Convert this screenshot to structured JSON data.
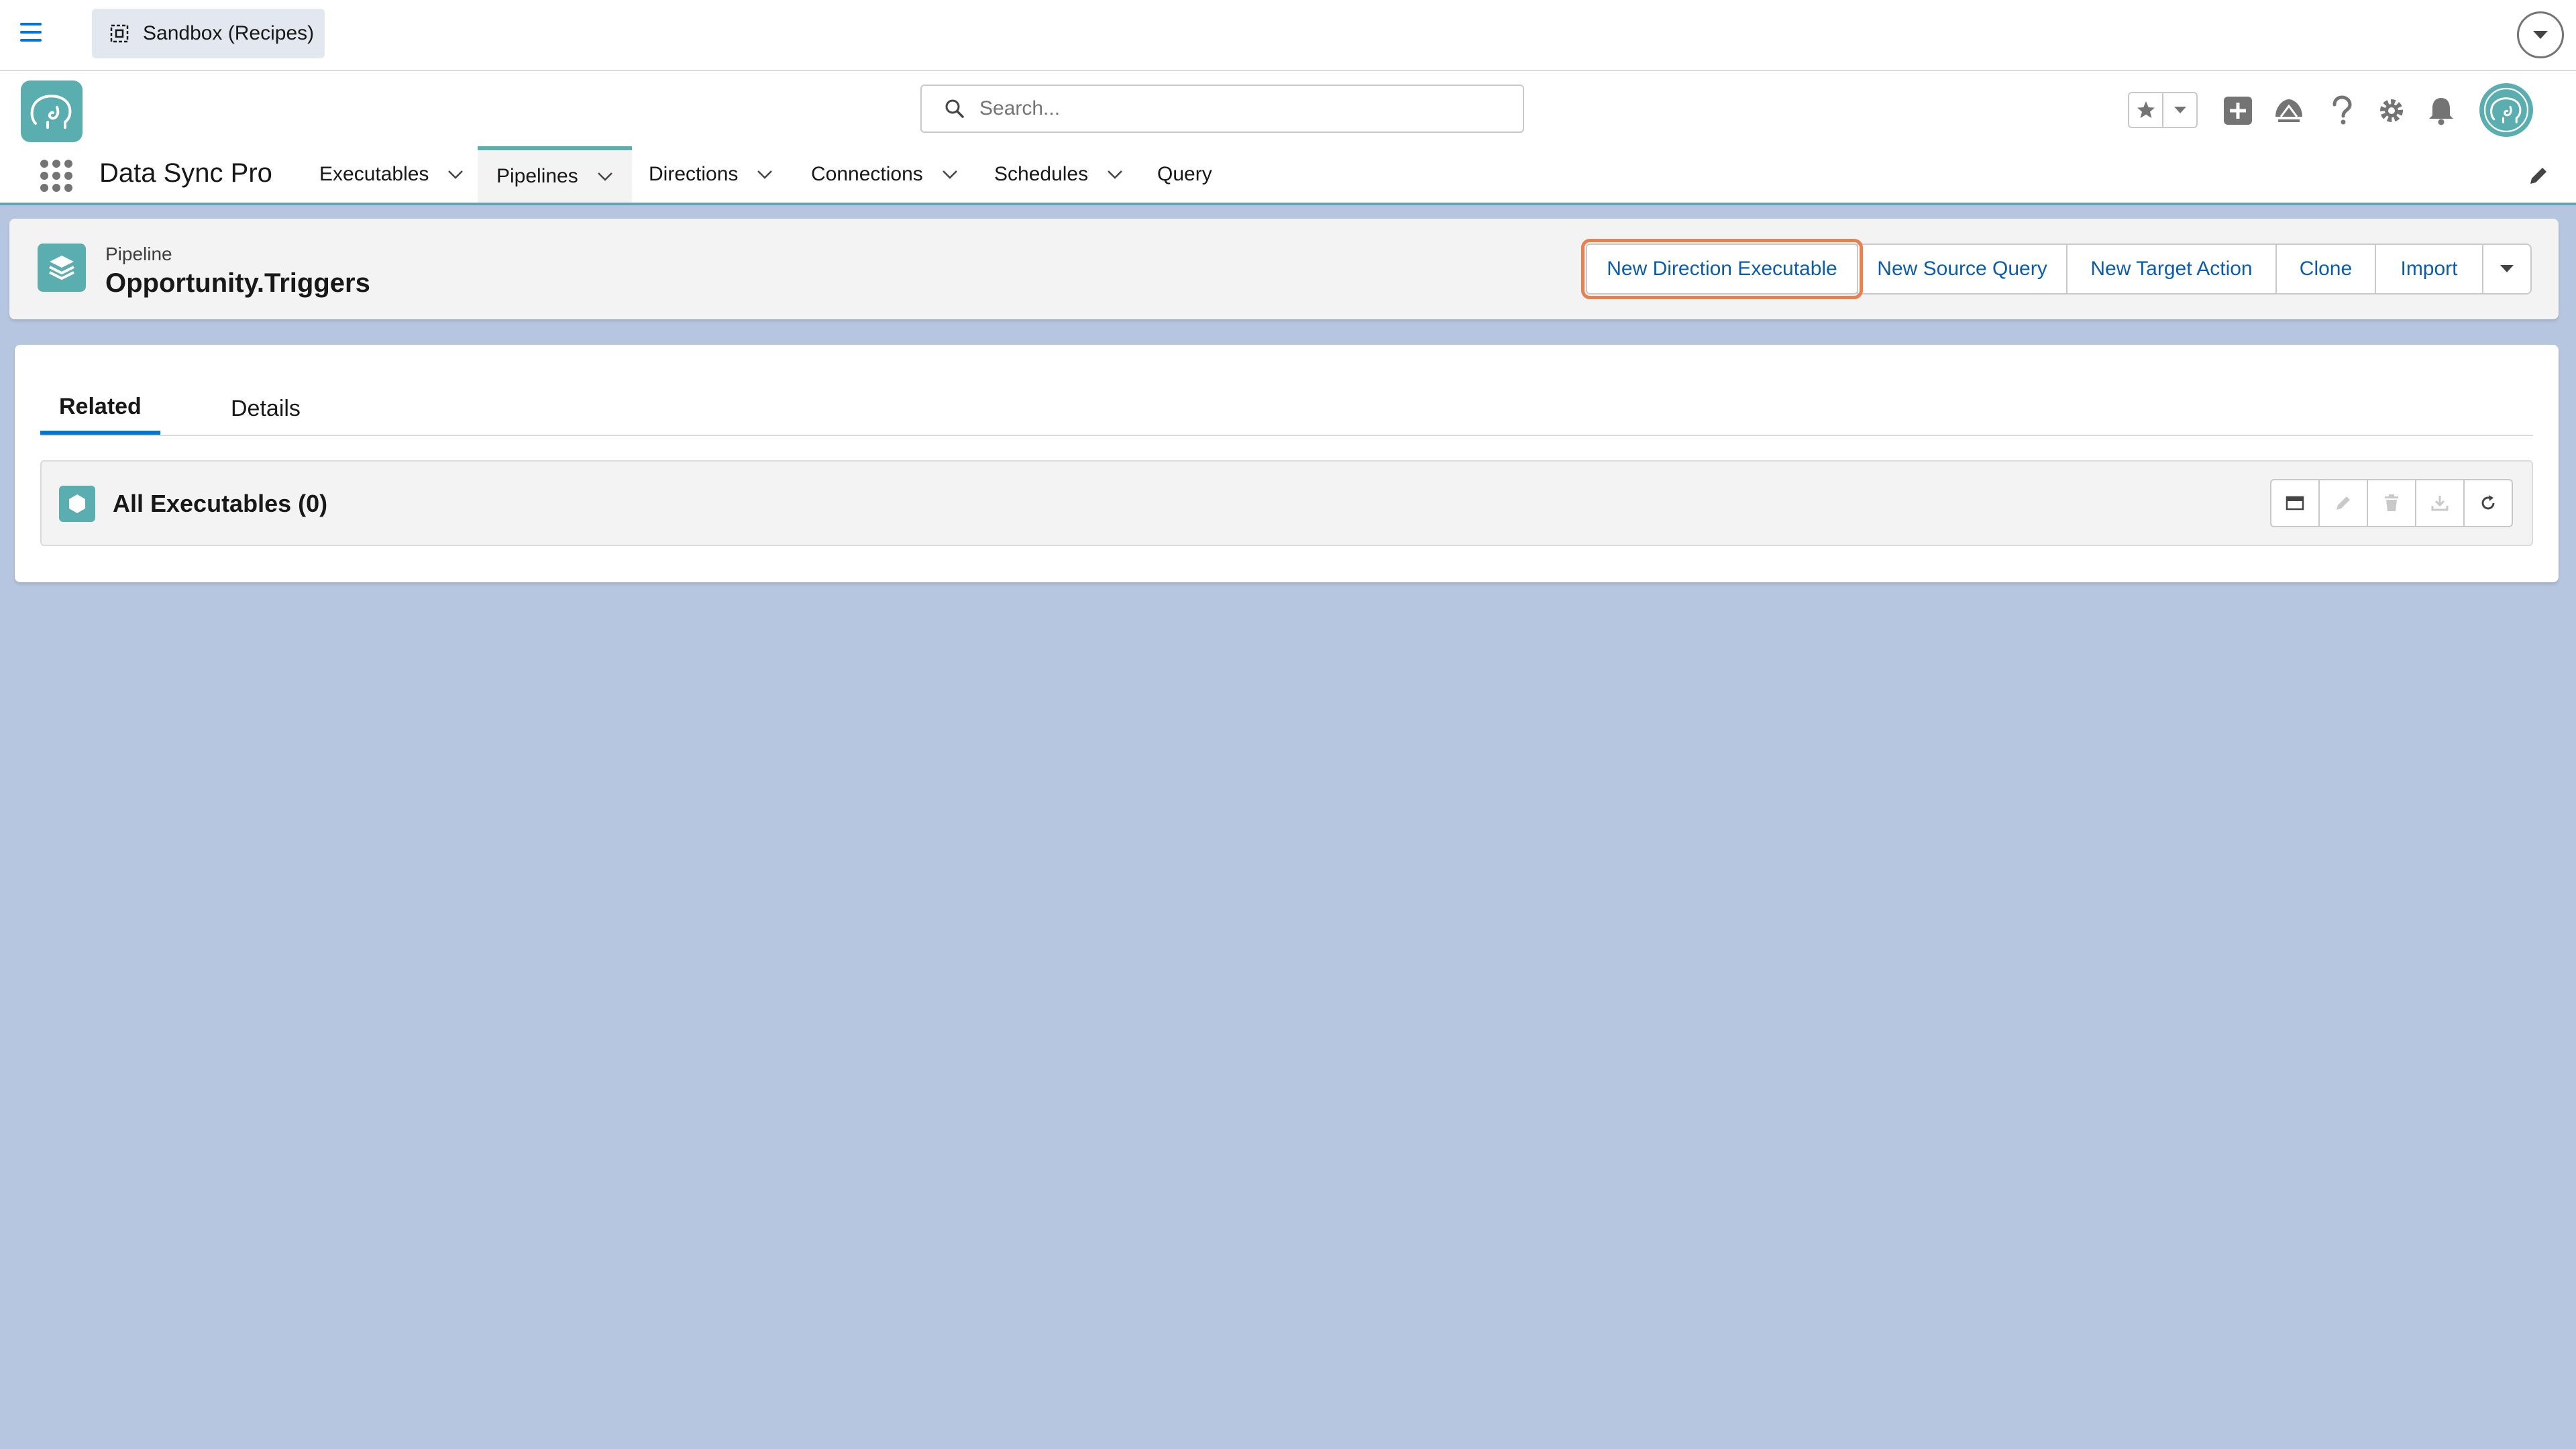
{
  "sandbox_bar": {
    "label": "Sandbox (Recipes)"
  },
  "header": {
    "search_placeholder": "Search...",
    "icons": [
      "favorites-star-icon",
      "favorites-dropdown-icon",
      "add-icon",
      "trailhead-icon",
      "help-icon",
      "setup-gear-icon",
      "notifications-bell-icon",
      "user-avatar-icon"
    ]
  },
  "nav": {
    "app_name": "Data Sync Pro",
    "items": [
      {
        "label": "Executables",
        "has_menu": true
      },
      {
        "label": "Pipelines",
        "has_menu": true,
        "active": true
      },
      {
        "label": "Directions",
        "has_menu": true
      },
      {
        "label": "Connections",
        "has_menu": true
      },
      {
        "label": "Schedules",
        "has_menu": true
      },
      {
        "label": "Query",
        "has_menu": false
      }
    ]
  },
  "record": {
    "type_label": "Pipeline",
    "title": "Opportunity.Triggers",
    "actions": [
      "New Direction Executable",
      "New Source Query",
      "New Target Action",
      "Clone",
      "Import"
    ]
  },
  "tabs": [
    {
      "label": "Related",
      "active": true
    },
    {
      "label": "Details",
      "active": false
    }
  ],
  "related_list": {
    "title": "All Executables (0)",
    "actions": [
      "display-as-table-icon",
      "edit-icon",
      "delete-icon",
      "download-icon",
      "refresh-icon"
    ]
  },
  "colors": {
    "brand_teal": "#5aaeb0",
    "link_blue": "#0b5cab",
    "focus_orange": "#e8804f",
    "background": "#b6c6e0"
  }
}
